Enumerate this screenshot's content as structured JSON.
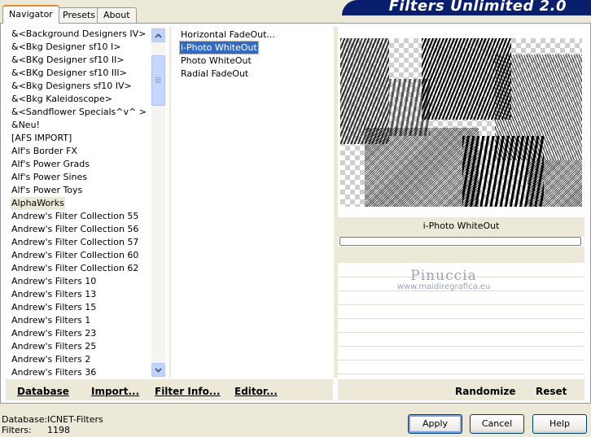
{
  "banner": {
    "title": "Filters Unlimited 2.0"
  },
  "tabs": [
    {
      "label": "Navigator",
      "active": true
    },
    {
      "label": "Presets",
      "active": false
    },
    {
      "label": "About",
      "active": false
    }
  ],
  "categories": {
    "items": [
      "&<Background Designers IV>",
      "&<Bkg Designer sf10 I>",
      "&<BKg Designer sf10 II>",
      "&<BKg Designer sf10 III>",
      "&<Bkg Designers sf10 IV>",
      "&<Bkg Kaleidoscope>",
      "&<Sandflower Specials^v^ >",
      "&Neu!",
      "[AFS IMPORT]",
      "Alf's Border FX",
      "Alf's Power Grads",
      "Alf's Power Sines",
      "Alf's Power Toys",
      "AlphaWorks",
      "Andrew's Filter Collection 55",
      "Andrew's Filter Collection 56",
      "Andrew's Filter Collection 57",
      "Andrew's Filter Collection 60",
      "Andrew's Filter Collection 62",
      "Andrew's Filters 10",
      "Andrew's Filters 13",
      "Andrew's Filters 15",
      "Andrew's Filters 1",
      "Andrew's Filters 23",
      "Andrew's Filters 25",
      "Andrew's Filters 2",
      "Andrew's Filters 36"
    ],
    "selected": "AlphaWorks"
  },
  "filters": {
    "items": [
      "Horizontal FadeOut...",
      "i-Photo WhiteOut",
      "Photo WhiteOut",
      "Radial FadeOut"
    ],
    "selected": "i-Photo WhiteOut"
  },
  "preview": {
    "filter_name": "i-Photo WhiteOut",
    "progress": 0
  },
  "watermark": {
    "name": "Pinuccia",
    "url": "www.maidiregrafica.eu"
  },
  "buttons_left": {
    "database": "Database",
    "import": "Import...",
    "filter_info": "Filter Info...",
    "editor": "Editor..."
  },
  "buttons_right": {
    "randomize": "Randomize",
    "reset": "Reset"
  },
  "status": {
    "database_label": "Database:",
    "database_value": "ICNET-Filters",
    "filters_label": "Filters:",
    "filters_value": "1198"
  },
  "dialog_buttons": {
    "apply": "Apply",
    "cancel": "Cancel",
    "help": "Help"
  },
  "colors": {
    "banner": "#0a1e6e",
    "selection": "#316ac5",
    "tab_accent": "#e68b2c",
    "face": "#ece9d8"
  }
}
